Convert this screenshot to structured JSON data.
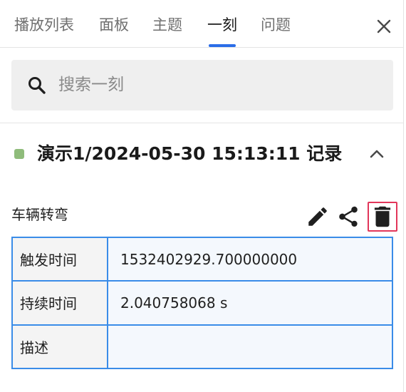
{
  "tabs": [
    {
      "label": "播放列表",
      "active": false
    },
    {
      "label": "面板",
      "active": false
    },
    {
      "label": "主题",
      "active": false
    },
    {
      "label": "一刻",
      "active": true
    },
    {
      "label": "问题",
      "active": false
    }
  ],
  "close_icon": "close-icon",
  "search": {
    "placeholder": "搜索一刻",
    "value": "",
    "icon": "search-icon"
  },
  "record": {
    "status_color": "#8fbc7b",
    "title": "演示1/2024-05-30 15:13:11 记录",
    "expanded": true,
    "event": {
      "name": "车辆转弯",
      "actions": [
        {
          "icon": "pencil-icon",
          "label": "edit"
        },
        {
          "icon": "share-icon",
          "label": "share"
        },
        {
          "icon": "trash-icon",
          "label": "delete",
          "highlighted": true,
          "highlight_color": "#e2365a"
        }
      ],
      "fields": [
        {
          "key": "触发时间",
          "value": "1532402929.700000000"
        },
        {
          "key": "持续时间",
          "value": "2.040758068 s"
        },
        {
          "key": "描述",
          "value": ""
        }
      ]
    }
  },
  "colors": {
    "accent": "#2b6de8",
    "table_border": "#3a8ce8"
  }
}
